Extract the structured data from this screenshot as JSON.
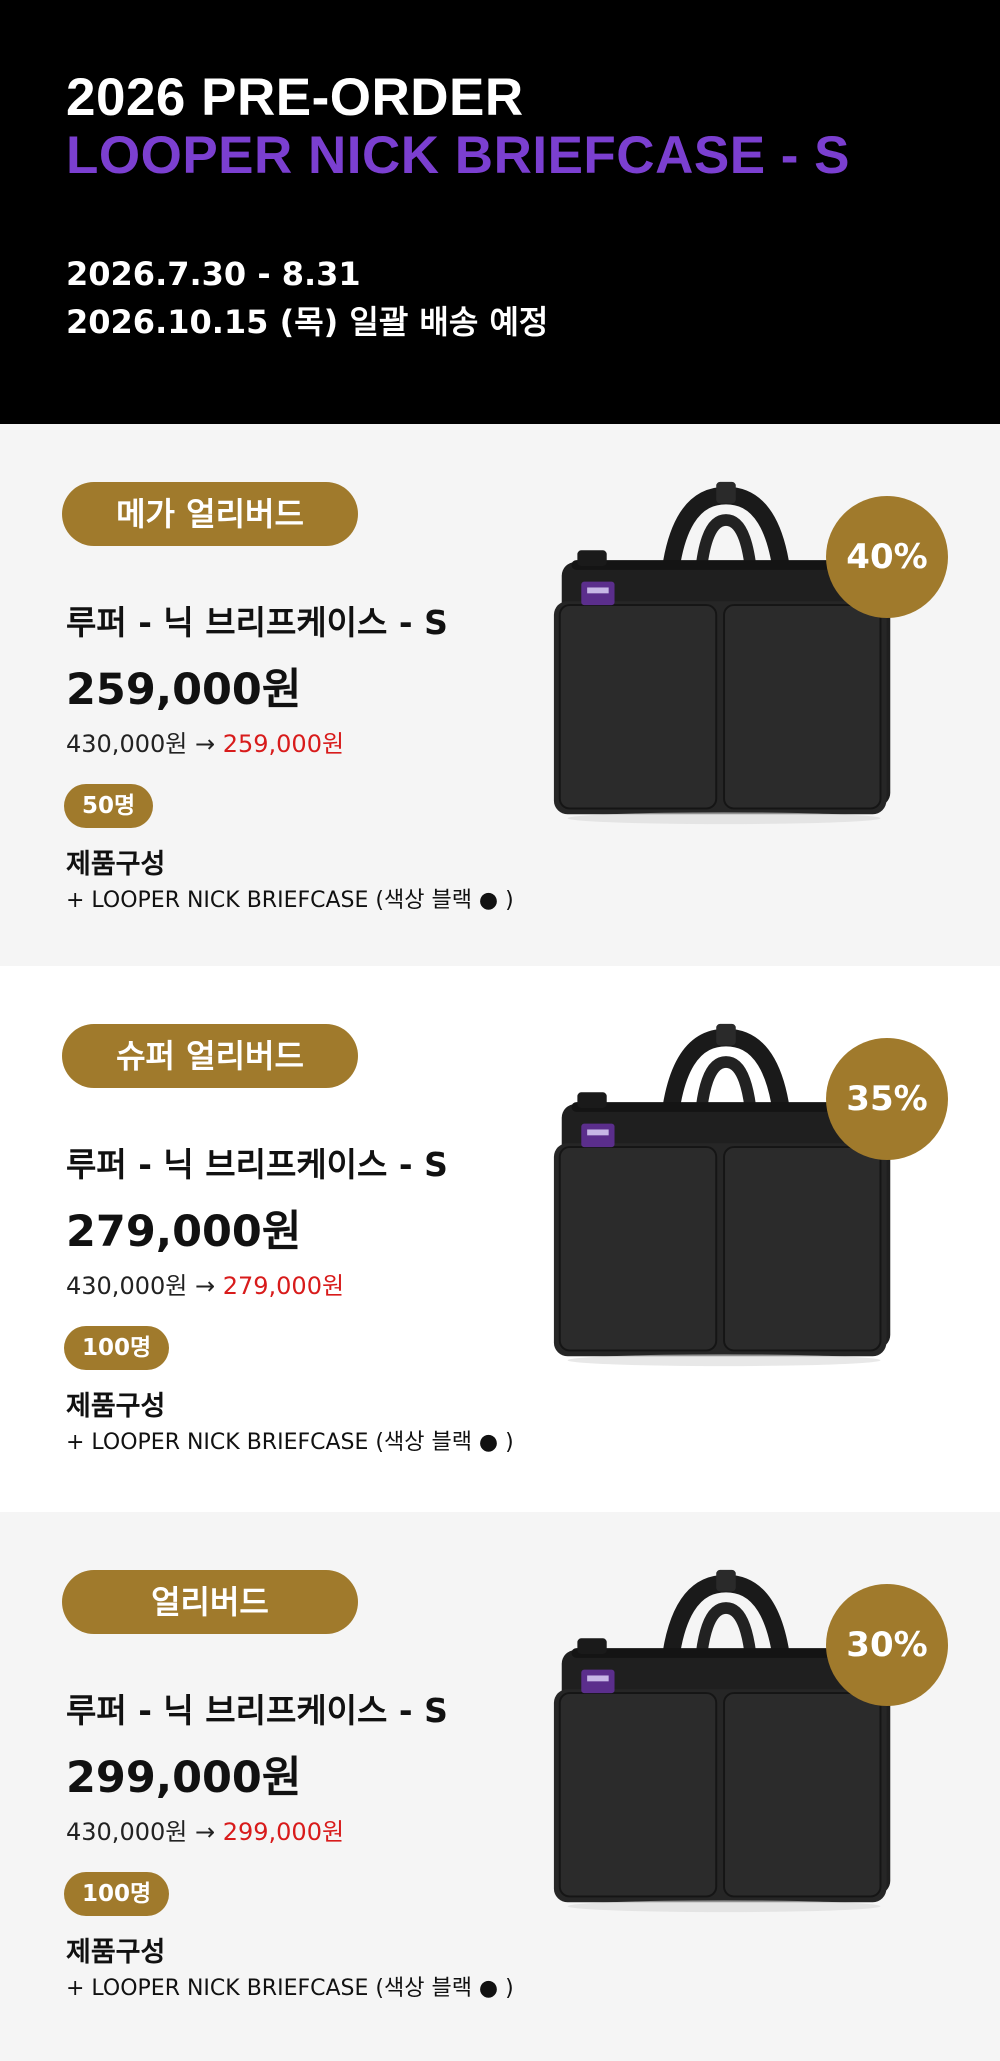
{
  "header": {
    "line1": "2026 PRE-ORDER",
    "line2": "LOOPER NICK BRIEFCASE - S",
    "period": "2026.7.30 - 8.31",
    "delivery": "2026.10.15 (목) 일괄 배송 예정"
  },
  "colors": {
    "accent_purple": "#7b3fd0",
    "gold": "#a07a2c",
    "sale_red": "#d81b1b",
    "hero_bg": "#000000"
  },
  "tiers": [
    {
      "badge": "메가 얼리버드",
      "name": "루퍼 - 닉 브리프케이스 - S",
      "price": "259,000원",
      "original": "430,000원",
      "arrow": "→",
      "sale": "259,000원",
      "quantity": "50명",
      "discount": "40%",
      "composition_title": "제품구성",
      "composition_item": "+ LOOPER NICK BRIEFCASE  (색상 블랙 ● )"
    },
    {
      "badge": "슈퍼 얼리버드",
      "name": "루퍼 - 닉 브리프케이스 - S",
      "price": "279,000원",
      "original": "430,000원",
      "arrow": "→",
      "sale": "279,000원",
      "quantity": "100명",
      "discount": "35%",
      "composition_title": "제품구성",
      "composition_item": "+ LOOPER NICK BRIEFCASE  (색상 블랙 ● )"
    },
    {
      "badge": "얼리버드",
      "name": "루퍼 - 닉 브리프케이스 - S",
      "price": "299,000원",
      "original": "430,000원",
      "arrow": "→",
      "sale": "299,000원",
      "quantity": "100명",
      "discount": "30%",
      "composition_title": "제품구성",
      "composition_item": "+ LOOPER NICK BRIEFCASE  (색상 블랙 ● )"
    }
  ]
}
